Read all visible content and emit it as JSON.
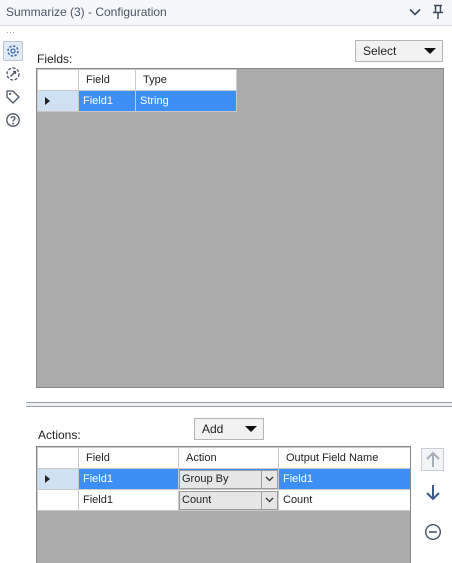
{
  "window": {
    "title": "Summarize (3) - Configuration"
  },
  "toolbar": {
    "drag_handle": "⋯"
  },
  "fields_panel": {
    "label": "Fields:",
    "select_button": "Select",
    "columns": [
      "Field",
      "Type"
    ],
    "rows": [
      {
        "field": "Field1",
        "type": "String",
        "selected": true
      }
    ]
  },
  "actions_panel": {
    "label": "Actions:",
    "add_button": "Add",
    "columns": [
      "Field",
      "Action",
      "Output Field Name"
    ],
    "rows": [
      {
        "field": "Field1",
        "action": "Group By",
        "output": "Field1",
        "selected": true
      },
      {
        "field": "Field1",
        "action": "Count",
        "output": "Count",
        "selected": false
      }
    ]
  },
  "colors": {
    "selection": "#3d8ff5",
    "grid_background": "#ababab",
    "row_header_selected": "#cfe0f2"
  },
  "icons": {
    "sidebar": [
      "gear-icon",
      "annotation-icon",
      "tag-icon",
      "help-icon"
    ],
    "titlebar": [
      "chevron-down-icon",
      "pin-icon"
    ],
    "action_buttons": [
      "move-up-icon",
      "move-down-icon",
      "remove-icon"
    ]
  }
}
